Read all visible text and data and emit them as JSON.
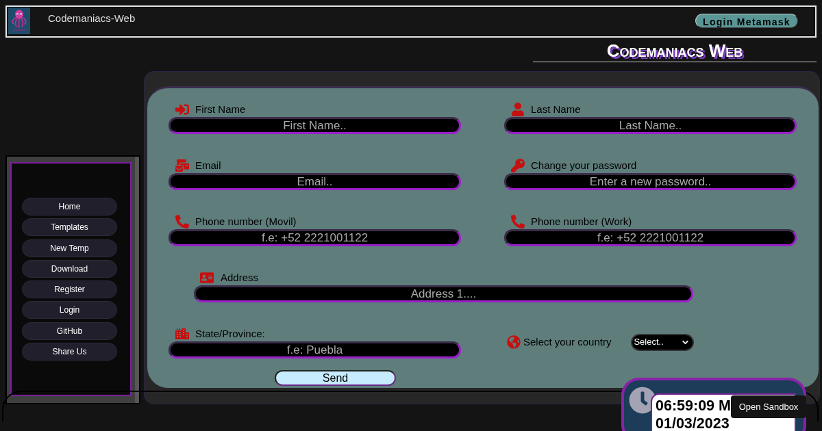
{
  "header": {
    "title": "Codemaniacs-Web",
    "login_button": "Login Metamask"
  },
  "heading": "Codemaniacs Web",
  "sidebar": {
    "items": [
      "Home",
      "Templates",
      "New Temp",
      "Download",
      "Register",
      "Login",
      "GitHub",
      "Share Us"
    ]
  },
  "form": {
    "rows": [
      {
        "fields": [
          {
            "kind": "input",
            "label": "First Name",
            "placeholder": "First Name.."
          },
          {
            "kind": "input",
            "label": "Last Name",
            "placeholder": "Last Name.."
          }
        ]
      },
      {
        "fields": [
          {
            "kind": "input",
            "label": "Email",
            "placeholder": "Email.."
          },
          {
            "kind": "input",
            "label": "Change your password",
            "placeholder": "Enter a new password.."
          }
        ]
      },
      {
        "fields": [
          {
            "kind": "input",
            "label": "Phone number (Movil)",
            "placeholder": "f.e: +52 2221001122"
          },
          {
            "kind": "input",
            "label": "Phone number (Work)",
            "placeholder": "f.e: +52 2221001122"
          }
        ]
      },
      {
        "fields": [
          {
            "kind": "wide_input",
            "label": "Address",
            "placeholder": "Address 1...."
          }
        ]
      },
      {
        "fields": [
          {
            "kind": "input",
            "label": "State/Province:",
            "placeholder": "f.e: Puebla"
          },
          {
            "kind": "select",
            "label": "Select your country",
            "value": "Select.."
          }
        ]
      }
    ],
    "submit_button": "Send"
  },
  "clock": {
    "time": "06:59:09 M",
    "date": "01/03/2023"
  },
  "sandbox_button": "Open Sandbox"
}
